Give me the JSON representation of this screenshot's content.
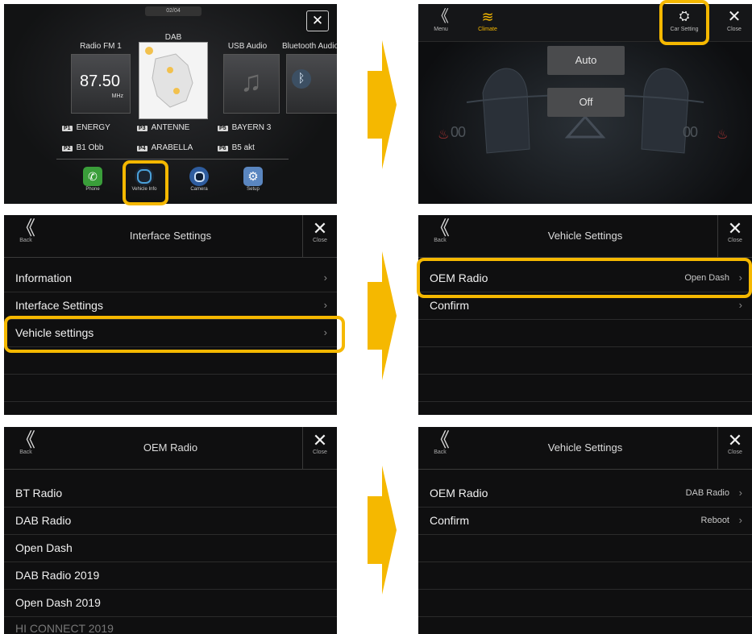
{
  "screen1": {
    "page_indicator": "02/04",
    "close_symbol": "✕",
    "sources": [
      {
        "label": "Radio FM 1"
      },
      {
        "label": "DAB"
      },
      {
        "label": "USB Audio"
      },
      {
        "label": "Bluetooth Audio"
      }
    ],
    "frequency": "87.50",
    "frequency_unit": "MHz",
    "presets": [
      {
        "num": "P1",
        "name": "ENERGY"
      },
      {
        "num": "P3",
        "name": "ANTENNE"
      },
      {
        "num": "P5",
        "name": "BAYERN 3"
      },
      {
        "num": "P2",
        "name": "B1 Obb"
      },
      {
        "num": "P4",
        "name": "ARABELLA"
      },
      {
        "num": "P6",
        "name": "B5 akt"
      }
    ],
    "dock": [
      {
        "label": "Phone",
        "icon": "phone-icon"
      },
      {
        "label": "Vehicle Info",
        "icon": "vehicle-info-icon"
      },
      {
        "label": "Camera",
        "icon": "camera-icon"
      },
      {
        "label": "Setup",
        "icon": "gear-icon"
      }
    ]
  },
  "screen2": {
    "menu_label": "Menu",
    "climate_label": "Climate",
    "car_setting_label": "Car Setting",
    "close_label": "Close",
    "auto_label": "Auto",
    "off_label": "Off",
    "left_fan": "00",
    "right_fan": "00"
  },
  "screen3": {
    "back_label": "Back",
    "title": "Interface Settings",
    "close_label": "Close",
    "rows": [
      "Information",
      "Interface Settings",
      "Vehicle settings"
    ]
  },
  "screen4": {
    "back_label": "Back",
    "title": "Vehicle Settings",
    "close_label": "Close",
    "rows": [
      {
        "label": "OEM Radio",
        "value": "Open Dash"
      },
      {
        "label": "Confirm",
        "value": ""
      }
    ]
  },
  "screen5": {
    "back_label": "Back",
    "title": "OEM Radio",
    "close_label": "Close",
    "rows": [
      "BT Radio",
      "DAB Radio",
      "Open Dash",
      "DAB Radio 2019",
      "Open Dash 2019",
      "HI CONNECT 2019"
    ]
  },
  "screen6": {
    "back_label": "Back",
    "title": "Vehicle Settings",
    "close_label": "Close",
    "rows": [
      {
        "label": "OEM Radio",
        "value": "DAB Radio"
      },
      {
        "label": "Confirm",
        "value": "Reboot"
      }
    ]
  },
  "colors": {
    "highlight": "#f5b800",
    "arrow": "#f5b800",
    "screen_bg": "#0f0f10"
  }
}
